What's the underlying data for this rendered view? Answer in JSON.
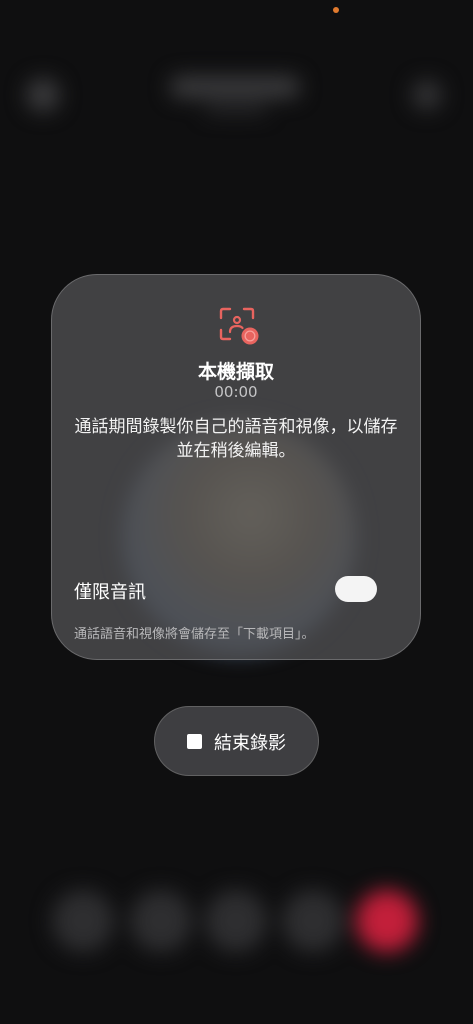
{
  "dialog": {
    "icon": "screen-capture-record-icon",
    "title": "本機擷取",
    "timer": "00:00",
    "description": "通話期間錄製你自己的語音和視像，以儲存並在稍後編輯。",
    "audio_only_label": "僅限音訊",
    "audio_only_enabled": false,
    "note": "通話語音和視像將會儲存至「下載項目」。"
  },
  "stop_button": {
    "icon": "stop-square-icon",
    "label": "結束錄影"
  },
  "colors": {
    "record_accent": "#e8645f",
    "end_call": "#c21f3a",
    "status_dot": "#e07a2e"
  }
}
